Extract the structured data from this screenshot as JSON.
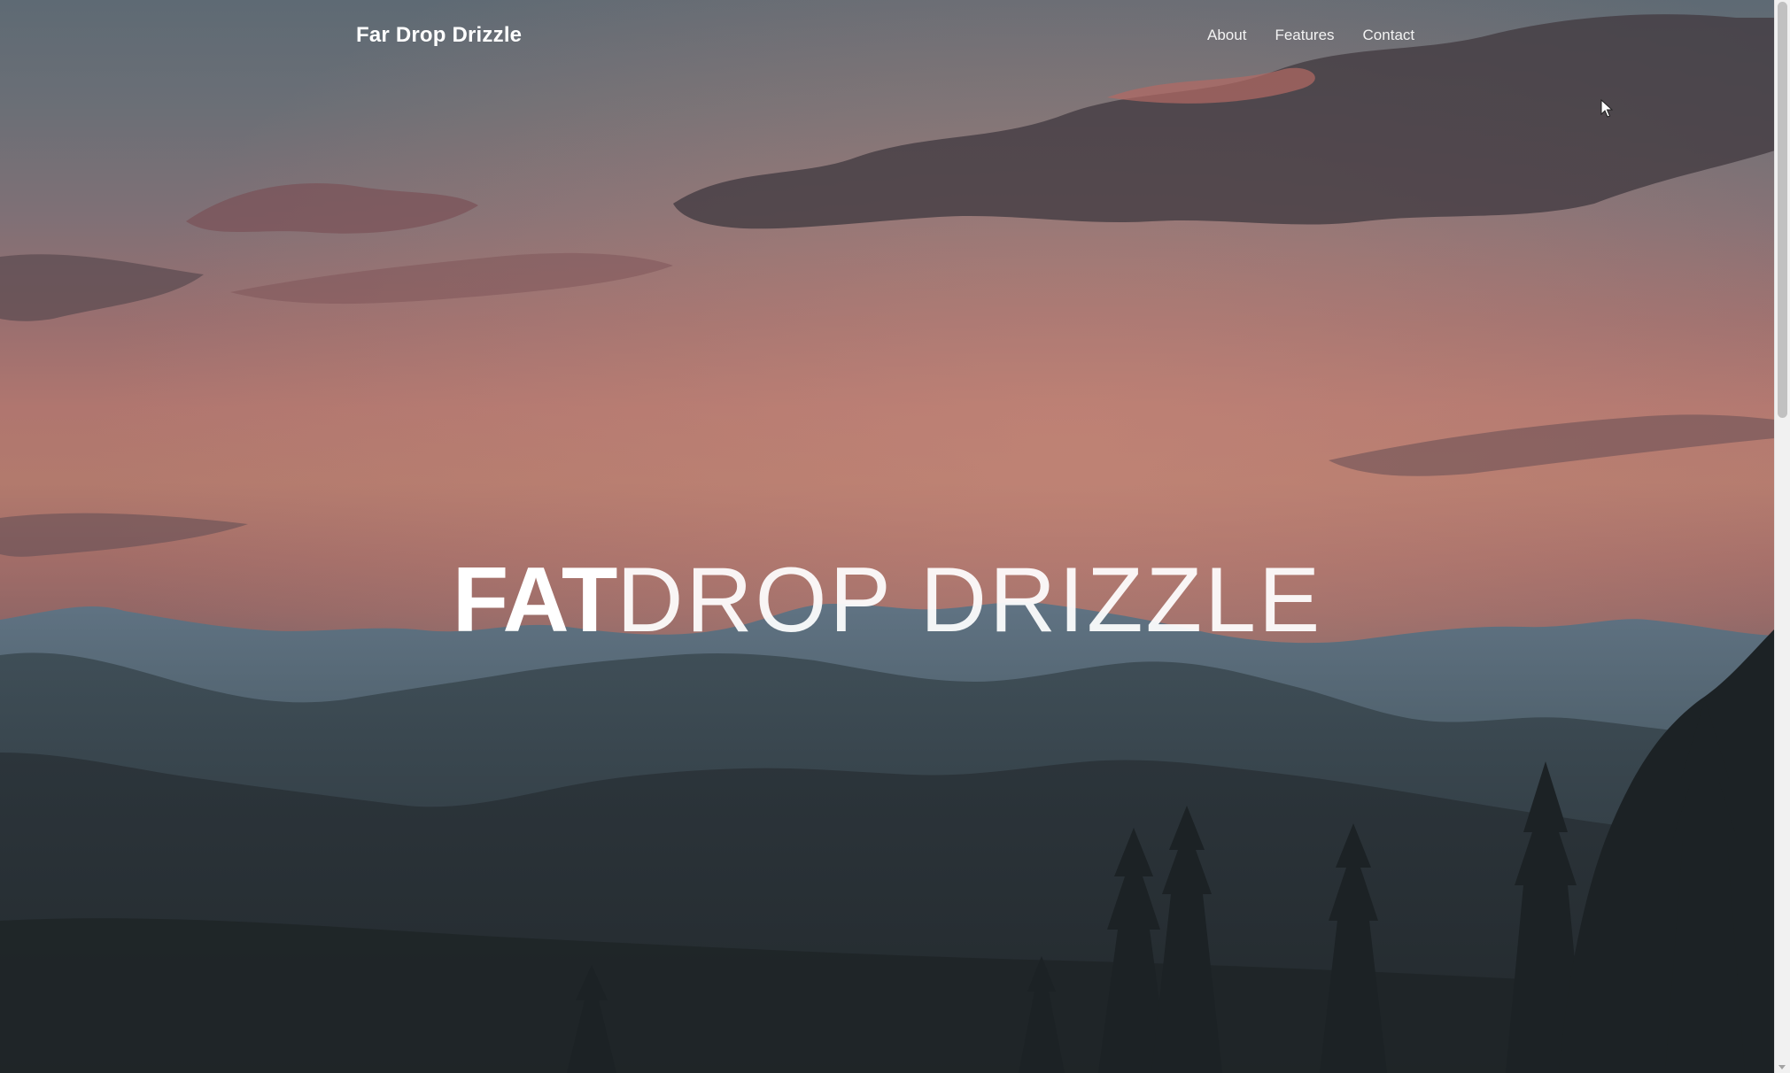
{
  "site": {
    "brand": "Far Drop Drizzle"
  },
  "nav": {
    "items": [
      {
        "label": "About"
      },
      {
        "label": "Features"
      },
      {
        "label": "Contact"
      }
    ]
  },
  "hero": {
    "headline_bold": "FAT",
    "headline_light": "DROP DRIZZLE",
    "background_scene": "sunset-mountains-image"
  },
  "colors": {
    "text": "#ffffff",
    "sky_top": "#5e6a74",
    "sky_glow": "#b0766f",
    "far_mountains": "#5c6e7a",
    "near_hills": "#2a3238",
    "scrollbar_track": "#f1f1f1",
    "scrollbar_thumb": "#c1c1c1"
  },
  "icons": {
    "cursor": "mouse-pointer-icon",
    "scroll_down": "scroll-down-arrow-icon"
  }
}
